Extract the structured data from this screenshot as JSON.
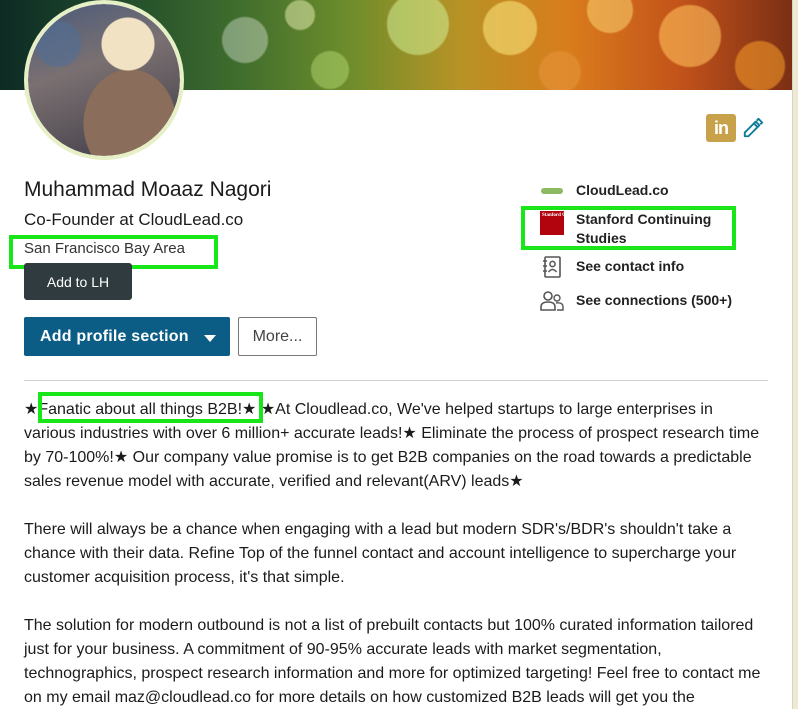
{
  "profile": {
    "name": "Muhammad Moaaz Nagori",
    "headline": "Co-Founder at CloudLead.co",
    "location": "San Francisco Bay Area"
  },
  "actions": {
    "add_to_lh": "Add to LH",
    "add_profile_section": "Add profile section",
    "more": "More..."
  },
  "header_icons": {
    "linkedin_label": "in",
    "linkedin_icon": "linkedin-icon",
    "edit_icon": "pencil-icon"
  },
  "sidebar": {
    "company": "CloudLead.co",
    "school_line1": "Stanford Continuing",
    "school_line2": "Studies",
    "contact_info": "See contact info",
    "connections": "See connections (500+)"
  },
  "summary": {
    "p1_star": "★",
    "p1_highlight": "Fanatic about all things B2B!",
    "p1_rest": "★ ★At Cloudlead.co, We've helped startups to large enterprises in various industries with over 6 million+ accurate leads!★ Eliminate the process of prospect research time by 70-100%!★ Our company value promise is to get B2B companies on the road towards a predictable sales revenue model with accurate, verified and relevant(ARV) leads★",
    "p2": "There will always be a chance when engaging with a lead but modern SDR's/BDR's shouldn't take a chance with their data. Refine Top of the funnel contact and account intelligence to supercharge your customer acquisition process, it's that simple.",
    "p3": "The solution for modern outbound is not a list of prebuilt contacts but 100% curated information tailored just for your business. A commitment of 90-95% accurate leads with market segmentation, technographics, prospect research information and more for optimized targeting! Feel free to contact me on my email maz@cloudlead.co for more details on how customized B2B leads will get you the"
  },
  "colors": {
    "highlight": "#19e619",
    "primary_button": "#0b5d86",
    "dark_button": "#2f3b3e",
    "linkedin_badge": "#c7a24a",
    "edit_icon": "#0b7a9a"
  }
}
